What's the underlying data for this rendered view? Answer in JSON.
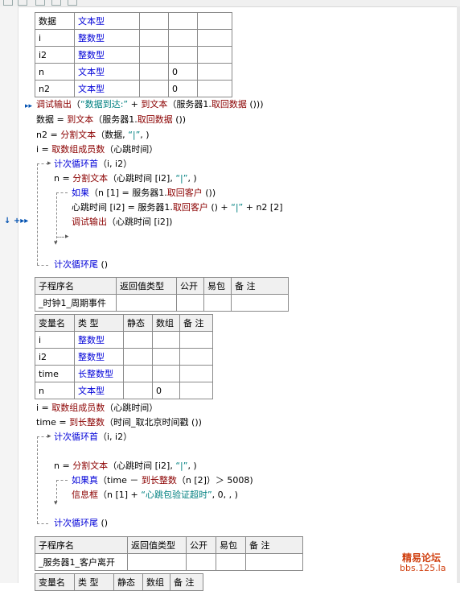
{
  "table1": {
    "rows": [
      [
        "数据",
        "文本型",
        "",
        "",
        ""
      ],
      [
        "i",
        "整数型",
        "",
        "",
        ""
      ],
      [
        "i2",
        "整数型",
        "",
        "",
        ""
      ],
      [
        "n",
        "文本型",
        "",
        "0",
        ""
      ],
      [
        "n2",
        "文本型",
        "",
        "0",
        ""
      ]
    ]
  },
  "code1": {
    "l1_fn": "调试输出",
    "l1_a": "（",
    "l1_str": "“数据到达:”",
    "l1_b": " + ",
    "l1_fn2": "到文本",
    "l1_c": "（服务器1.",
    "l1_fn3": "取回数据",
    "l1_d": " ()))",
    "l2_a": "数据 = ",
    "l2_fn": "到文本",
    "l2_b": "（服务器1.",
    "l2_fn2": "取回数据",
    "l2_c": " ())",
    "l3_a": "n2 = ",
    "l3_fn": "分割文本",
    "l3_b": "（数据, ",
    "l3_str": "“|”",
    "l3_c": ", )",
    "l4_a": "i = ",
    "l4_fn": "取数组成员数",
    "l4_b": "（心跳时间）",
    "l5_fn": "计次循环首",
    "l5_b": "（i, i2）",
    "l6_a": "n = ",
    "l6_fn": "分割文本",
    "l6_b": "（心跳时间 [i2], ",
    "l6_str": "“|”",
    "l6_c": ", )",
    "l7_fn": "如果",
    "l7_b": "（n [1] = 服务器1.",
    "l7_fn2": "取回客户",
    "l7_c": " ())",
    "l8_a": "心跳时间 [i2] = 服务器1.",
    "l8_fn": "取回客户",
    "l8_b": " () + ",
    "l8_str": "“|”",
    "l8_c": " + n2 [2]",
    "l9_fn": "调试输出",
    "l9_b": "（心跳时间 [i2])",
    "l10_fn": "计次循环尾",
    "l10_b": " ()"
  },
  "sub1": {
    "header": [
      "子程序名",
      "返回值类型",
      "公开",
      "易包",
      "备 注"
    ],
    "row": [
      "_时钟1_周期事件",
      "",
      "",
      "",
      ""
    ]
  },
  "table2": {
    "header": [
      "变量名",
      "类 型",
      "静态",
      "数组",
      "备 注"
    ],
    "rows": [
      [
        "i",
        "整数型",
        "",
        "",
        ""
      ],
      [
        "i2",
        "整数型",
        "",
        "",
        ""
      ],
      [
        "time",
        "长整数型",
        "",
        "",
        ""
      ],
      [
        "n",
        "文本型",
        "",
        "0",
        ""
      ]
    ]
  },
  "code2": {
    "l1_a": "i = ",
    "l1_fn": "取数组成员数",
    "l1_b": "（心跳时间）",
    "l2_a": "time = ",
    "l2_fn": "到长整数",
    "l2_b": "（时间_取北京时间戳 ())",
    "l3_fn": "计次循环首",
    "l3_b": "（i, i2）",
    "l4_a": "n = ",
    "l4_fn": "分割文本",
    "l4_b": "（心跳时间 [i2], ",
    "l4_str": "“|”",
    "l4_c": ", )",
    "l5_fn": "如果真",
    "l5_b": "（time － ",
    "l5_fn2": "到长整数",
    "l5_c": "（n [2]）＞ 5008)",
    "l6_fn": "信息框",
    "l6_b": "（n [1] + ",
    "l6_str": "“心跳包验证超时”",
    "l6_c": ", 0, , )",
    "l7_fn": "计次循环尾",
    "l7_b": " ()"
  },
  "sub2": {
    "header": [
      "子程序名",
      "返回值类型",
      "公开",
      "易包",
      "备 注"
    ],
    "row": [
      "_服务器1_客户离开",
      "",
      "",
      "",
      ""
    ]
  },
  "table3": {
    "header": [
      "变量名",
      "类 型",
      "静态",
      "数组",
      "备 注"
    ]
  },
  "gutter": {
    "arrow1": "▸▸",
    "marker": "↓ +▸▸"
  },
  "watermark": {
    "line1": "精易论坛",
    "line2": "bbs.125.la"
  }
}
